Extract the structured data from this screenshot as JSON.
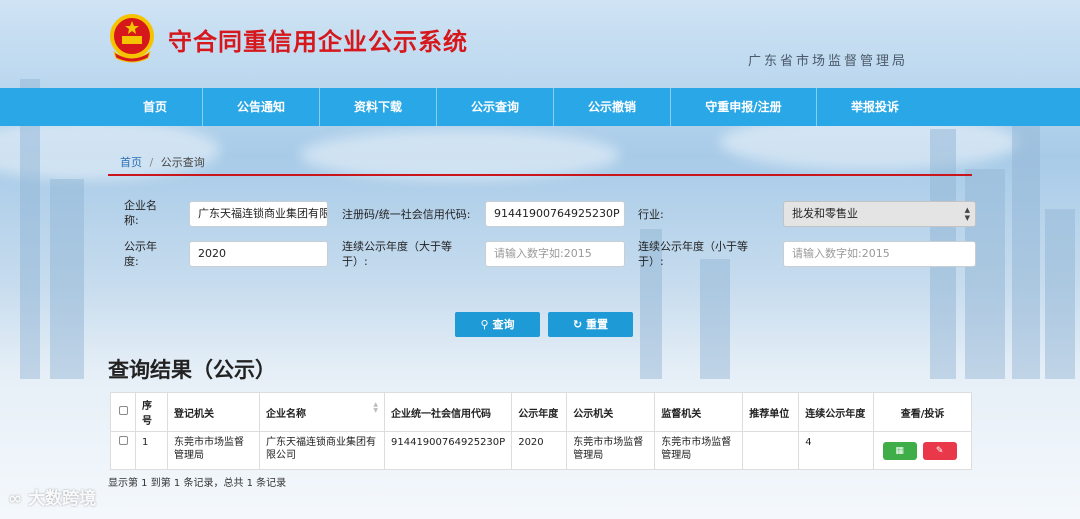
{
  "header": {
    "title": "守合同重信用企业公示系统",
    "org": "广东省市场监督管理局"
  },
  "nav": [
    "首页",
    "公告通知",
    "资料下载",
    "公示查询",
    "公示撤销",
    "守重申报/注册",
    "举报投诉"
  ],
  "breadcrumb": {
    "home": "首页",
    "sep": "/",
    "current": "公示查询"
  },
  "form": {
    "company_label": "企业名称:",
    "company_value": "广东天福连锁商业集团有限",
    "code_label": "注册码/统一社会信用代码:",
    "code_value": "91441900764925230P",
    "industry_label": "行业:",
    "industry_value": "批发和零售业",
    "year_label": "公示年度:",
    "year_value": "2020",
    "min_label": "连续公示年度（大于等于）:",
    "min_placeholder": "请输入数字如:2015",
    "max_label": "连续公示年度（小于等于）:",
    "max_placeholder": "请输入数字如:2015"
  },
  "buttons": {
    "search": "查询",
    "reset": "重置"
  },
  "results": {
    "title": "查询结果（公示）",
    "columns": [
      "序号",
      "登记机关",
      "企业名称",
      "企业统一社会信用代码",
      "公示年度",
      "公示机关",
      "监督机关",
      "推荐单位",
      "连续公示年度",
      "查看/投诉"
    ],
    "rows": [
      {
        "index": "1",
        "reg_authority": "东莞市市场监督管理局",
        "company": "广东天福连锁商业集团有限公司",
        "credit_code": "91441900764925230P",
        "year": "2020",
        "pub_authority": "东莞市市场监督管理局",
        "sup_authority": "东莞市市场监督管理局",
        "recommender": "",
        "consecutive": "4"
      }
    ],
    "summary": "显示第 1 到第 1 条记录，总共 1 条记录"
  },
  "watermark": "大数跨境",
  "colors": {
    "nav": "#2aa7e6",
    "title_red": "#d6171c",
    "button_blue": "#1e9ad6",
    "rule_red": "#c9161c"
  }
}
